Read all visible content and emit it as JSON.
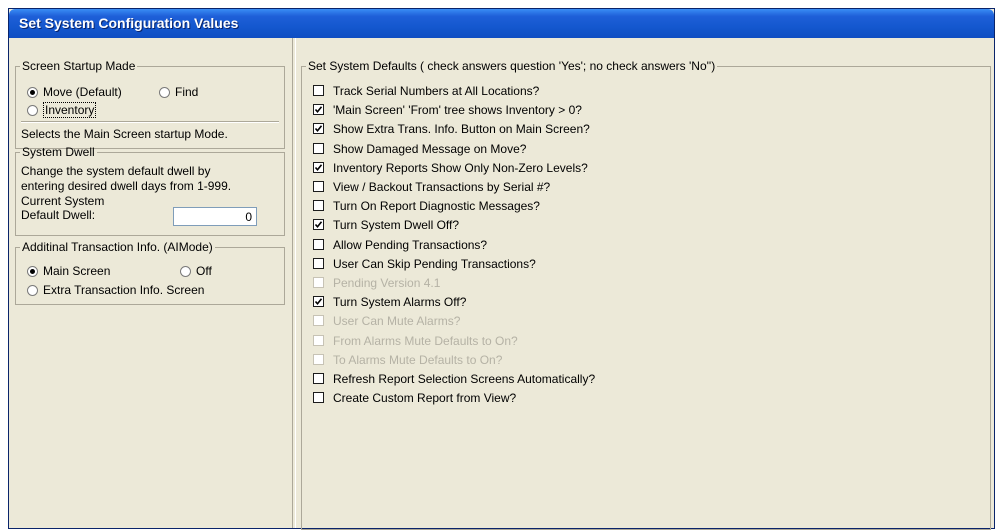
{
  "window": {
    "title": "Set System Configuration Values"
  },
  "left": {
    "startup_mode": {
      "legend": "Screen Startup Made",
      "options": [
        {
          "label": "Move (Default)",
          "selected": true
        },
        {
          "label": "Find",
          "selected": false
        },
        {
          "label": "Inventory",
          "selected": false
        }
      ],
      "description": "Selects the Main Screen startup Mode."
    },
    "dwell": {
      "legend": "System Dwell",
      "line1": "Change the system default dwell by",
      "line2": "entering desired dwell days from 1-999.",
      "current_label_1": "Current System",
      "current_label_2": "Default Dwell:",
      "value": "0"
    },
    "additional_info": {
      "legend": "Additinal Transaction Info. (AIMode)",
      "options": [
        {
          "label": "Main Screen",
          "selected": true
        },
        {
          "label": "Off",
          "selected": false
        },
        {
          "label": "Extra Transaction Info. Screen",
          "selected": false
        }
      ]
    }
  },
  "defaults": {
    "legend": "Set System Defaults  ( check answers question 'Yes'; no check answers 'No'')",
    "items": [
      {
        "label": "Track Serial Numbers at All Locations?",
        "checked": false,
        "enabled": true
      },
      {
        "label": "'Main Screen' 'From' tree shows Inventory > 0?",
        "checked": true,
        "enabled": true
      },
      {
        "label": "Show Extra Trans. Info. Button on Main Screen?",
        "checked": true,
        "enabled": true
      },
      {
        "label": "Show Damaged Message on Move?",
        "checked": false,
        "enabled": true
      },
      {
        "label": "Inventory Reports Show Only Non-Zero Levels?",
        "checked": true,
        "enabled": true
      },
      {
        "label": "View / Backout Transactions by Serial #?",
        "checked": false,
        "enabled": true
      },
      {
        "label": "Turn On Report Diagnostic Messages?",
        "checked": false,
        "enabled": true
      },
      {
        "label": "Turn System Dwell Off?",
        "checked": true,
        "enabled": true
      },
      {
        "label": "Allow Pending Transactions?",
        "checked": false,
        "enabled": true
      },
      {
        "label": "User Can Skip Pending Transactions?",
        "checked": false,
        "enabled": true
      },
      {
        "label": "Pending Version 4.1",
        "checked": false,
        "enabled": false
      },
      {
        "label": "Turn System Alarms Off?",
        "checked": true,
        "enabled": true
      },
      {
        "label": "User Can Mute Alarms?",
        "checked": false,
        "enabled": false
      },
      {
        "label": "From Alarms Mute Defaults to On?",
        "checked": false,
        "enabled": false
      },
      {
        "label": "To Alarms Mute Defaults to On?",
        "checked": false,
        "enabled": false
      },
      {
        "label": "Refresh Report Selection Screens Automatically?",
        "checked": false,
        "enabled": true
      },
      {
        "label": "Create Custom Report from View?",
        "checked": false,
        "enabled": true
      }
    ]
  }
}
